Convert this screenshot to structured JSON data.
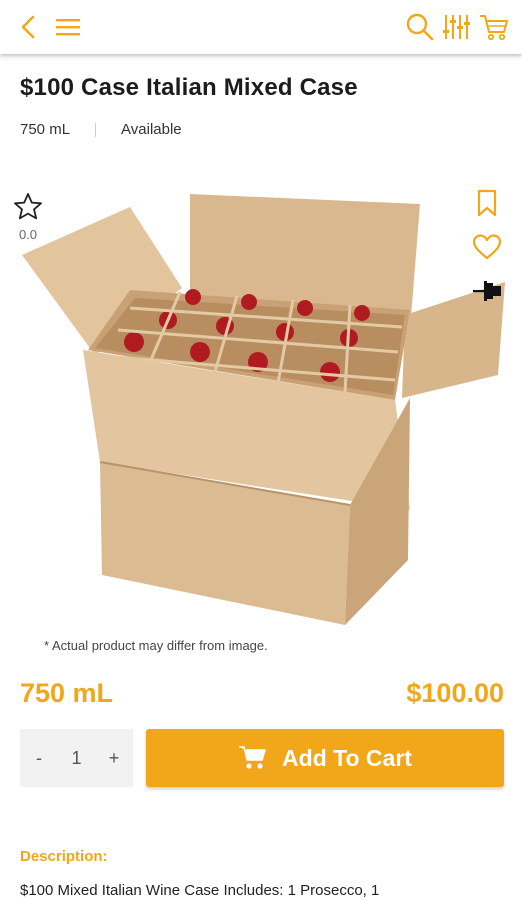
{
  "header": {
    "back_icon": "chevron-left-icon",
    "menu_icon": "hamburger-menu-icon",
    "search_icon": "search-icon",
    "filter_icon": "filter-sliders-icon",
    "cart_icon": "cart-icon",
    "accent_color": "#f2a71b"
  },
  "product": {
    "title": "$100 Case Italian Mixed Case",
    "size": "750 mL",
    "availability": "Available",
    "rating": "0.0",
    "disclaimer": "* Actual product may differ from image.",
    "volume_display": "750 mL",
    "price": "$100.00",
    "image": "wine-case-box-image"
  },
  "side_actions": {
    "bookmark_icon": "bookmark-icon",
    "favorite_icon": "heart-icon",
    "pin_icon": "pin-icon"
  },
  "cart_controls": {
    "minus_label": "-",
    "quantity": "1",
    "plus_label": "+",
    "add_label": "Add To Cart"
  },
  "description": {
    "heading": "Description:",
    "text": "$100 Mixed Italian Wine Case Includes: 1 Prosecco, 1"
  }
}
